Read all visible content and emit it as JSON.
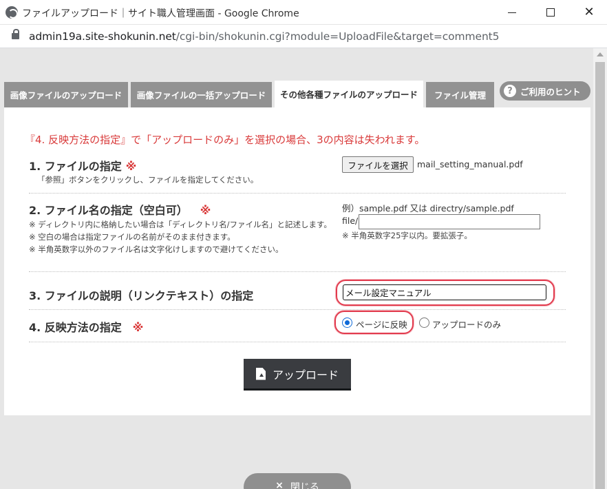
{
  "window": {
    "title": "ファイルアップロード｜サイト職人管理画面 - Google Chrome",
    "url_host": "admin19a.site-shokunin.net",
    "url_path": "/cgi-bin/shokunin.cgi?module=UploadFile&target=comment5"
  },
  "tabs": [
    {
      "label": "画像ファイルのアップロード"
    },
    {
      "label": "画像ファイルの一括アップロード"
    },
    {
      "label": "その他各種ファイルのアップロード",
      "active": true
    },
    {
      "label": "ファイル管理"
    }
  ],
  "hint": {
    "label": "ご利用のヒント",
    "icon": "?"
  },
  "warning": "『4. 反映方法の指定』で「アップロードのみ」を選択の場合、3の内容は失われます。",
  "sections": {
    "file": {
      "label": "1. ファイルの指定",
      "required": "※",
      "note": "「参照」ボタンをクリックし、ファイルを指定してください。",
      "button": "ファイルを選択",
      "selected": "mail_setting_manual.pdf"
    },
    "filename": {
      "label": "2. ファイル名の指定（空白可）",
      "required": "※",
      "notes": [
        "※ ディレクトリ内に格納したい場合は「ディレクトリ名/ファイル名」と記述します。",
        "※ 空白の場合は指定ファイルの名前がそのまま付きます。",
        "※ 半角英数字以外のファイル名は文字化けしますので避けてください。"
      ],
      "example": "例）sample.pdf 又は directry/sample.pdf",
      "prefix": "file/",
      "value": "",
      "hint": "※ 半角英数字25字以内。要拡張子。"
    },
    "description": {
      "label": "3. ファイルの説明（リンクテキスト）の指定",
      "value": "メール設定マニュアル"
    },
    "method": {
      "label": "4. 反映方法の指定",
      "required": "※",
      "options": [
        {
          "label": "ページに反映",
          "checked": true
        },
        {
          "label": "アップロードのみ",
          "checked": false
        }
      ]
    }
  },
  "upload_button": "アップロード",
  "close_button": {
    "icon": "×",
    "label": "閉じる"
  },
  "colors": {
    "accent_red": "#d93a3a",
    "radio_blue": "#0f6ad8",
    "tab_gray": "#929292"
  }
}
